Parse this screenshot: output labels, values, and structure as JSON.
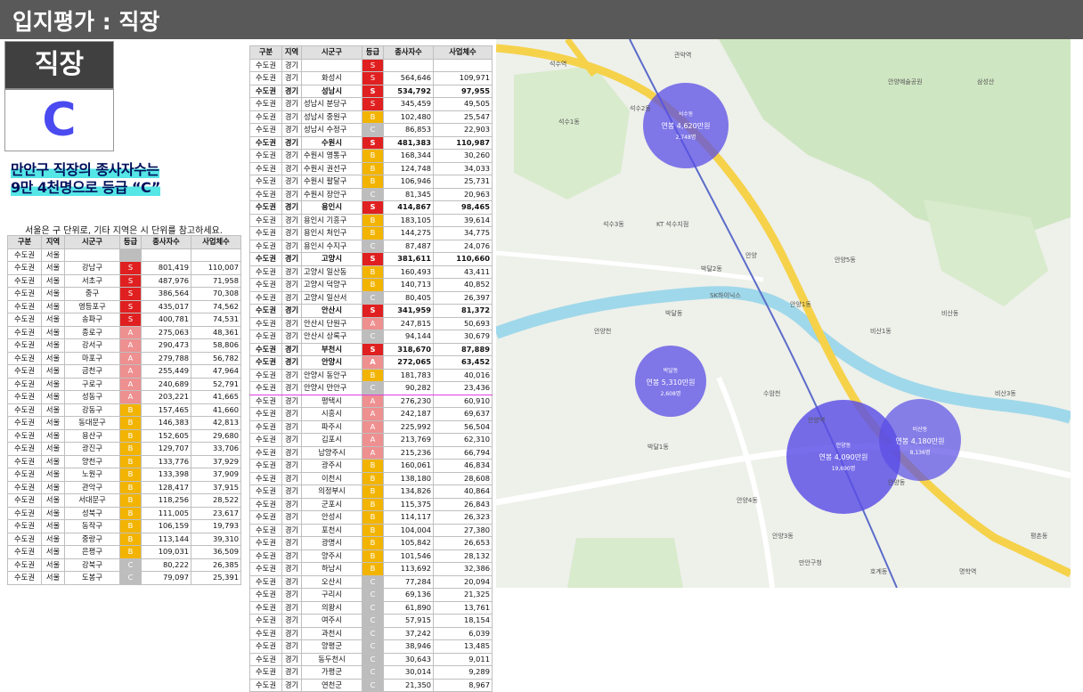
{
  "header": {
    "title": "입지평가 : 직장"
  },
  "grade_box": {
    "label": "직장",
    "grade": "C"
  },
  "description": {
    "line1": "만안구 직장의 종사자수는",
    "line2": "9만 4천명으로 등급 “C”"
  },
  "note": "서울은 구 단위로, 기타 지역은 시 단위를 참고하세요.",
  "table_headers": [
    "구분",
    "지역",
    "시군구",
    "등급",
    "종사자수",
    "사업체수"
  ],
  "table1": [
    [
      "수도권",
      "서울",
      "",
      "",
      "",
      ""
    ],
    [
      "수도권",
      "서울",
      "강남구",
      "S",
      "801,419",
      "110,007"
    ],
    [
      "수도권",
      "서울",
      "서초구",
      "S",
      "487,976",
      "71,958"
    ],
    [
      "수도권",
      "서울",
      "중구",
      "S",
      "386,564",
      "70,308"
    ],
    [
      "수도권",
      "서울",
      "영등포구",
      "S",
      "435,017",
      "74,562"
    ],
    [
      "수도권",
      "서울",
      "송파구",
      "S",
      "400,781",
      "74,531"
    ],
    [
      "수도권",
      "서울",
      "종로구",
      "A",
      "275,063",
      "48,361"
    ],
    [
      "수도권",
      "서울",
      "강서구",
      "A",
      "290,473",
      "58,806"
    ],
    [
      "수도권",
      "서울",
      "마포구",
      "A",
      "279,788",
      "56,782"
    ],
    [
      "수도권",
      "서울",
      "금천구",
      "A",
      "255,449",
      "47,964"
    ],
    [
      "수도권",
      "서울",
      "구로구",
      "A",
      "240,689",
      "52,791"
    ],
    [
      "수도권",
      "서울",
      "성동구",
      "A",
      "203,221",
      "41,665"
    ],
    [
      "수도권",
      "서울",
      "강동구",
      "B",
      "157,465",
      "41,660"
    ],
    [
      "수도권",
      "서울",
      "동대문구",
      "B",
      "146,383",
      "42,813"
    ],
    [
      "수도권",
      "서울",
      "용산구",
      "B",
      "152,605",
      "29,680"
    ],
    [
      "수도권",
      "서울",
      "광진구",
      "B",
      "129,707",
      "33,706"
    ],
    [
      "수도권",
      "서울",
      "양천구",
      "B",
      "133,776",
      "37,929"
    ],
    [
      "수도권",
      "서울",
      "노원구",
      "B",
      "133,398",
      "37,909"
    ],
    [
      "수도권",
      "서울",
      "관악구",
      "B",
      "128,417",
      "37,915"
    ],
    [
      "수도권",
      "서울",
      "서대문구",
      "B",
      "118,256",
      "28,522"
    ],
    [
      "수도권",
      "서울",
      "성북구",
      "B",
      "111,005",
      "23,617"
    ],
    [
      "수도권",
      "서울",
      "동작구",
      "B",
      "106,159",
      "19,793"
    ],
    [
      "수도권",
      "서울",
      "중랑구",
      "B",
      "113,144",
      "39,310"
    ],
    [
      "수도권",
      "서울",
      "은평구",
      "B",
      "109,031",
      "36,509"
    ],
    [
      "수도권",
      "서울",
      "강북구",
      "C",
      "80,222",
      "26,385"
    ],
    [
      "수도권",
      "서울",
      "도봉구",
      "C",
      "79,097",
      "25,391"
    ]
  ],
  "table2": [
    [
      "수도권",
      "경기",
      "",
      "S",
      "",
      ""
    ],
    [
      "수도권",
      "경기",
      "화성시",
      "S",
      "564,646",
      "109,971"
    ],
    [
      "수도권",
      "경기",
      "성남시",
      "S",
      "534,792",
      "97,955"
    ],
    [
      "수도권",
      "경기",
      "성남시 분당구",
      "S",
      "345,459",
      "49,505"
    ],
    [
      "수도권",
      "경기",
      "성남시 중원구",
      "B",
      "102,480",
      "25,547"
    ],
    [
      "수도권",
      "경기",
      "성남시 수정구",
      "C",
      "86,853",
      "22,903"
    ],
    [
      "수도권",
      "경기",
      "수원시",
      "S",
      "481,383",
      "110,987"
    ],
    [
      "수도권",
      "경기",
      "수원시 영통구",
      "B",
      "168,344",
      "30,260"
    ],
    [
      "수도권",
      "경기",
      "수원시 권선구",
      "B",
      "124,748",
      "34,033"
    ],
    [
      "수도권",
      "경기",
      "수원시 팔달구",
      "B",
      "106,946",
      "25,731"
    ],
    [
      "수도권",
      "경기",
      "수원시 장안구",
      "C",
      "81,345",
      "20,963"
    ],
    [
      "수도권",
      "경기",
      "용인시",
      "S",
      "414,867",
      "98,465"
    ],
    [
      "수도권",
      "경기",
      "용인시 기흥구",
      "B",
      "183,105",
      "39,614"
    ],
    [
      "수도권",
      "경기",
      "용인시 처인구",
      "B",
      "144,275",
      "34,775"
    ],
    [
      "수도권",
      "경기",
      "용인시 수지구",
      "C",
      "87,487",
      "24,076"
    ],
    [
      "수도권",
      "경기",
      "고양시",
      "S",
      "381,611",
      "110,660"
    ],
    [
      "수도권",
      "경기",
      "고양시 일산동",
      "B",
      "160,493",
      "43,411"
    ],
    [
      "수도권",
      "경기",
      "고양시 덕양구",
      "B",
      "140,713",
      "40,852"
    ],
    [
      "수도권",
      "경기",
      "고양시 일산서",
      "C",
      "80,405",
      "26,397"
    ],
    [
      "수도권",
      "경기",
      "안산시",
      "S",
      "341,959",
      "81,372"
    ],
    [
      "수도권",
      "경기",
      "안산시 단원구",
      "A",
      "247,815",
      "50,693"
    ],
    [
      "수도권",
      "경기",
      "안산시 상록구",
      "C",
      "94,144",
      "30,679"
    ],
    [
      "수도권",
      "경기",
      "부천시",
      "S",
      "318,670",
      "87,889"
    ],
    [
      "수도권",
      "경기",
      "안양시",
      "A",
      "272,065",
      "63,452"
    ],
    [
      "수도권",
      "경기",
      "안양시 동안구",
      "B",
      "181,783",
      "40,016"
    ],
    [
      "수도권",
      "경기",
      "안양시 만안구",
      "C",
      "90,282",
      "23,436"
    ],
    [
      "수도권",
      "경기",
      "평택시",
      "A",
      "276,230",
      "60,910"
    ],
    [
      "수도권",
      "경기",
      "시흥시",
      "A",
      "242,187",
      "69,637"
    ],
    [
      "수도권",
      "경기",
      "파주시",
      "A",
      "225,992",
      "56,504"
    ],
    [
      "수도권",
      "경기",
      "김포시",
      "A",
      "213,769",
      "62,310"
    ],
    [
      "수도권",
      "경기",
      "남양주시",
      "A",
      "215,236",
      "66,794"
    ],
    [
      "수도권",
      "경기",
      "광주시",
      "B",
      "160,061",
      "46,834"
    ],
    [
      "수도권",
      "경기",
      "이천시",
      "B",
      "138,180",
      "28,608"
    ],
    [
      "수도권",
      "경기",
      "의정부시",
      "B",
      "134,826",
      "40,864"
    ],
    [
      "수도권",
      "경기",
      "군포시",
      "B",
      "115,375",
      "26,843"
    ],
    [
      "수도권",
      "경기",
      "안성시",
      "B",
      "114,117",
      "26,323"
    ],
    [
      "수도권",
      "경기",
      "포천시",
      "B",
      "104,004",
      "27,380"
    ],
    [
      "수도권",
      "경기",
      "광명시",
      "B",
      "105,842",
      "26,653"
    ],
    [
      "수도권",
      "경기",
      "양주시",
      "B",
      "101,546",
      "28,132"
    ],
    [
      "수도권",
      "경기",
      "하남시",
      "B",
      "113,692",
      "32,386"
    ],
    [
      "수도권",
      "경기",
      "오산시",
      "C",
      "77,284",
      "20,094"
    ],
    [
      "수도권",
      "경기",
      "구리시",
      "C",
      "69,136",
      "21,325"
    ],
    [
      "수도권",
      "경기",
      "의왕시",
      "C",
      "61,890",
      "13,761"
    ],
    [
      "수도권",
      "경기",
      "여주시",
      "C",
      "57,915",
      "18,154"
    ],
    [
      "수도권",
      "경기",
      "과천시",
      "C",
      "37,242",
      "6,039"
    ],
    [
      "수도권",
      "경기",
      "양평군",
      "C",
      "38,946",
      "13,485"
    ],
    [
      "수도권",
      "경기",
      "동두천시",
      "C",
      "30,643",
      "9,011"
    ],
    [
      "수도권",
      "경기",
      "가평군",
      "C",
      "30,014",
      "9,289"
    ],
    [
      "수도권",
      "경기",
      "연천군",
      "C",
      "21,350",
      "8,967"
    ]
  ],
  "table2_bold_rows": [
    2,
    6,
    11,
    15,
    19,
    22,
    23
  ],
  "table2_highlight_row": 25,
  "map": {
    "circles": [
      {
        "name": "석수동",
        "income": "연봉 4,620만원",
        "workers": "2,748명"
      },
      {
        "name": "박달동",
        "income": "연봉 5,310만원",
        "workers": "2,608명"
      },
      {
        "name": "안양동",
        "income": "연봉 4,090만원",
        "workers": "19,690명"
      },
      {
        "name": "비산동",
        "income": "연봉 4,180만원",
        "workers": "8,136명"
      }
    ],
    "labels": [
      "석수2동",
      "석수1동",
      "석수3동",
      "박달동",
      "박달1동",
      "안양1동",
      "안양3동",
      "안양4동",
      "안양5동",
      "비산1동",
      "비산3동",
      "수암천",
      "호계동",
      "만안구청",
      "안양역",
      "명학역",
      "석수역",
      "관악역",
      "안양예술공원",
      "박달2동",
      "삼성산",
      "비산동",
      "KT 석수지점",
      "SK하이닉스",
      "안양천",
      "안양",
      "안양동",
      "평촌동"
    ],
    "colors": {
      "circle": "#5a4de6",
      "road_yellow": "#f5d24a",
      "river": "#9fd8ea",
      "park": "#cfe6c2"
    }
  }
}
